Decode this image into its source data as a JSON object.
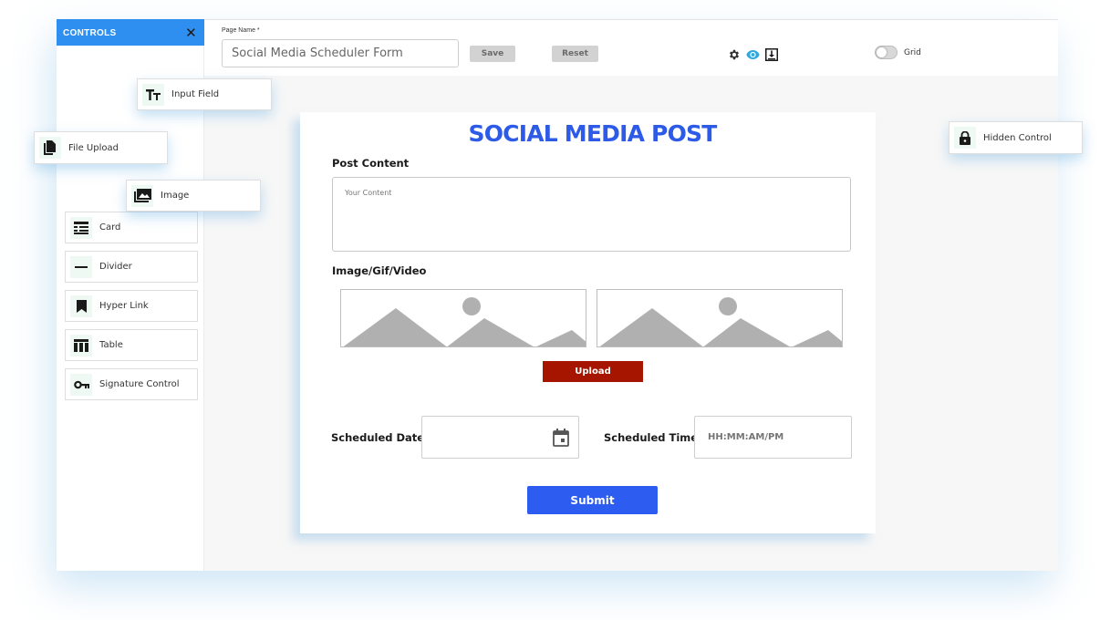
{
  "sidebar": {
    "header": "CONTROLS",
    "close_icon": "close-icon",
    "items": [
      {
        "label": "Card",
        "icon": "card-icon"
      },
      {
        "label": "Divider",
        "icon": "divider-icon"
      },
      {
        "label": "Hyper Link",
        "icon": "bookmark-icon"
      },
      {
        "label": "Table",
        "icon": "table-icon"
      },
      {
        "label": "Signature Control",
        "icon": "key-icon"
      }
    ]
  },
  "floating_controls": [
    {
      "label": "Input Field",
      "icon": "text-icon"
    },
    {
      "label": "File Upload",
      "icon": "file-icon"
    },
    {
      "label": "Image",
      "icon": "image-icon"
    },
    {
      "label": "Hidden Control",
      "icon": "lock-icon"
    }
  ],
  "toolbar": {
    "page_name_label": "Page Name *",
    "page_name_value": "Social Media Scheduler Form",
    "save_label": "Save",
    "reset_label": "Reset",
    "icons": [
      "gear-icon",
      "eye-icon",
      "download-icon"
    ],
    "grid_label": "Grid",
    "grid_enabled": false
  },
  "form": {
    "title": "SOCIAL MEDIA POST",
    "post_content_label": "Post Content",
    "post_content_placeholder": "Your Content",
    "media_label": "Image/Gif/Video",
    "upload_label": "Upload",
    "scheduled_date_label": "Scheduled Date",
    "scheduled_time_label": "Scheduled Time",
    "scheduled_time_placeholder": "HH:MM:AM/PM",
    "submit_label": "Submit"
  },
  "colors": {
    "accent": "#2f8ff0",
    "title": "#2d5be8",
    "upload": "#a61500",
    "submit": "#2d5cf0",
    "eye_icon": "#2fa8e0"
  }
}
